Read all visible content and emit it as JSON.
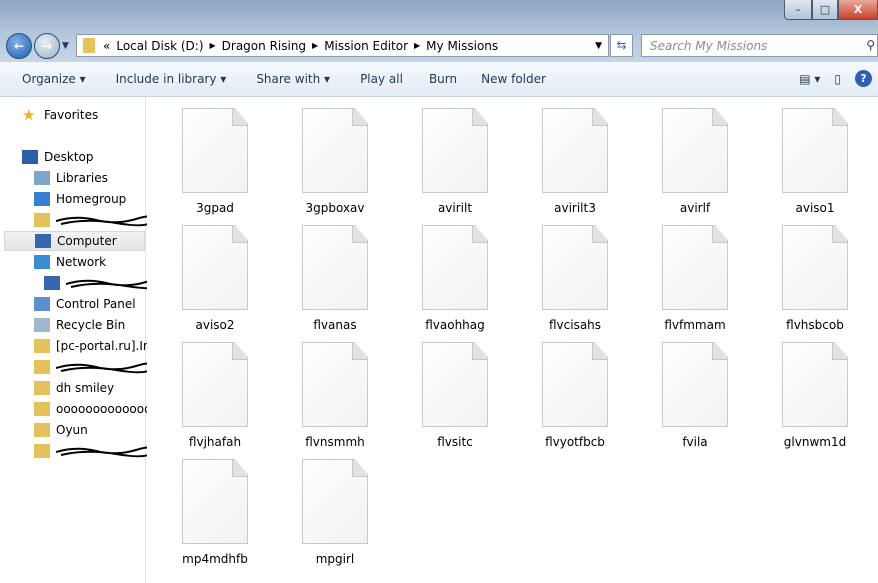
{
  "window": {
    "minimize": "–",
    "maximize": "□",
    "close": "X"
  },
  "address": {
    "overflow": "«",
    "crumbs": [
      "Local Disk (D:)",
      "Dragon Rising",
      "Mission Editor",
      "My Missions"
    ]
  },
  "search": {
    "placeholder": "Search My Missions"
  },
  "toolbar": {
    "organize": "Organize ▾",
    "include": "Include in library ▾",
    "share": "Share with ▾",
    "play": "Play all",
    "burn": "Burn",
    "newfolder": "New folder"
  },
  "sidebar": {
    "favorites": "Favorites",
    "items": [
      {
        "label": "Desktop",
        "icon": "desktop-icon"
      },
      {
        "label": "Libraries",
        "icon": "libraries-icon"
      },
      {
        "label": "Homegroup",
        "icon": "homegroup-icon"
      },
      {
        "label": "",
        "icon": "folder-icon",
        "redacted": true
      },
      {
        "label": "Computer",
        "icon": "computer-icon",
        "selected": true
      },
      {
        "label": "Network",
        "icon": "network-icon"
      },
      {
        "label": "",
        "icon": "computer-icon",
        "redacted": true
      },
      {
        "label": "Control Panel",
        "icon": "control-panel-icon"
      },
      {
        "label": "Recycle Bin",
        "icon": "recycle-bin-icon"
      },
      {
        "label": "[pc-portal.ru].Ini",
        "icon": "folder-icon"
      },
      {
        "label": "",
        "icon": "folder-icon",
        "redacted": true
      },
      {
        "label": "dh smiley",
        "icon": "folder-icon"
      },
      {
        "label": "oooooooooooooo",
        "icon": "folder-icon"
      },
      {
        "label": "Oyun",
        "icon": "folder-icon"
      },
      {
        "label": "",
        "icon": "folder-icon",
        "redacted": true
      }
    ]
  },
  "files": [
    "3gpad",
    "3gpboxav",
    "avirilt",
    "avirilt3",
    "avirlf",
    "aviso1",
    "aviso2",
    "flvanas",
    "flvaohhag",
    "flvcisahs",
    "flvfmmam",
    "flvhsbcob",
    "flvjhafah",
    "flvnsmmh",
    "flvsitc",
    "flvyotfbcb",
    "fvila",
    "glvnwm1d",
    "mp4mdhfb",
    "mpgirl"
  ]
}
